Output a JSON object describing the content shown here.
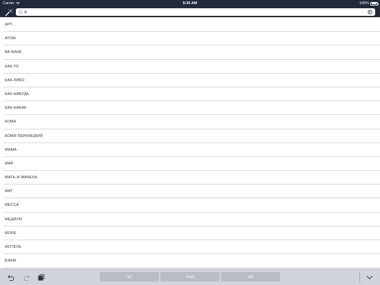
{
  "status": {
    "carrier": "Carrier",
    "time": "9:30 AM",
    "battery": "100%"
  },
  "search": {
    "value": "А"
  },
  "results": [
    "АРТ...",
    "АТОМ",
    "ВА-БАНК",
    "КАК-ТО",
    "КАК-ЛИБО",
    "КАК-НИБУДЬ",
    "КАК-НИКАК",
    "КОМА",
    "КОМИ-ПЕРМЯЦКИЙ",
    "МАМА",
    "МАР",
    "МАТЬ-И-МАЧЕХА",
    "МАТ",
    "МЕССА",
    "МЕДИУМ",
    "МОРЕ",
    "МОТЕЛЬ",
    "ЁЖИК"
  ],
  "toolbar": {
    "chips": [
      "\"А\"",
      "And",
      "All"
    ]
  },
  "icons": {
    "wand": "magic-wand-icon",
    "search": "magnifier-icon",
    "clear": "clear-x-icon",
    "undo": "undo-icon",
    "redo": "redo-icon",
    "copy": "copy-icon",
    "dismiss": "chevron-down-icon"
  },
  "colors": {
    "header": "#22293a",
    "toolbar": "#d1d4db",
    "chip": "#b8bcc5"
  }
}
